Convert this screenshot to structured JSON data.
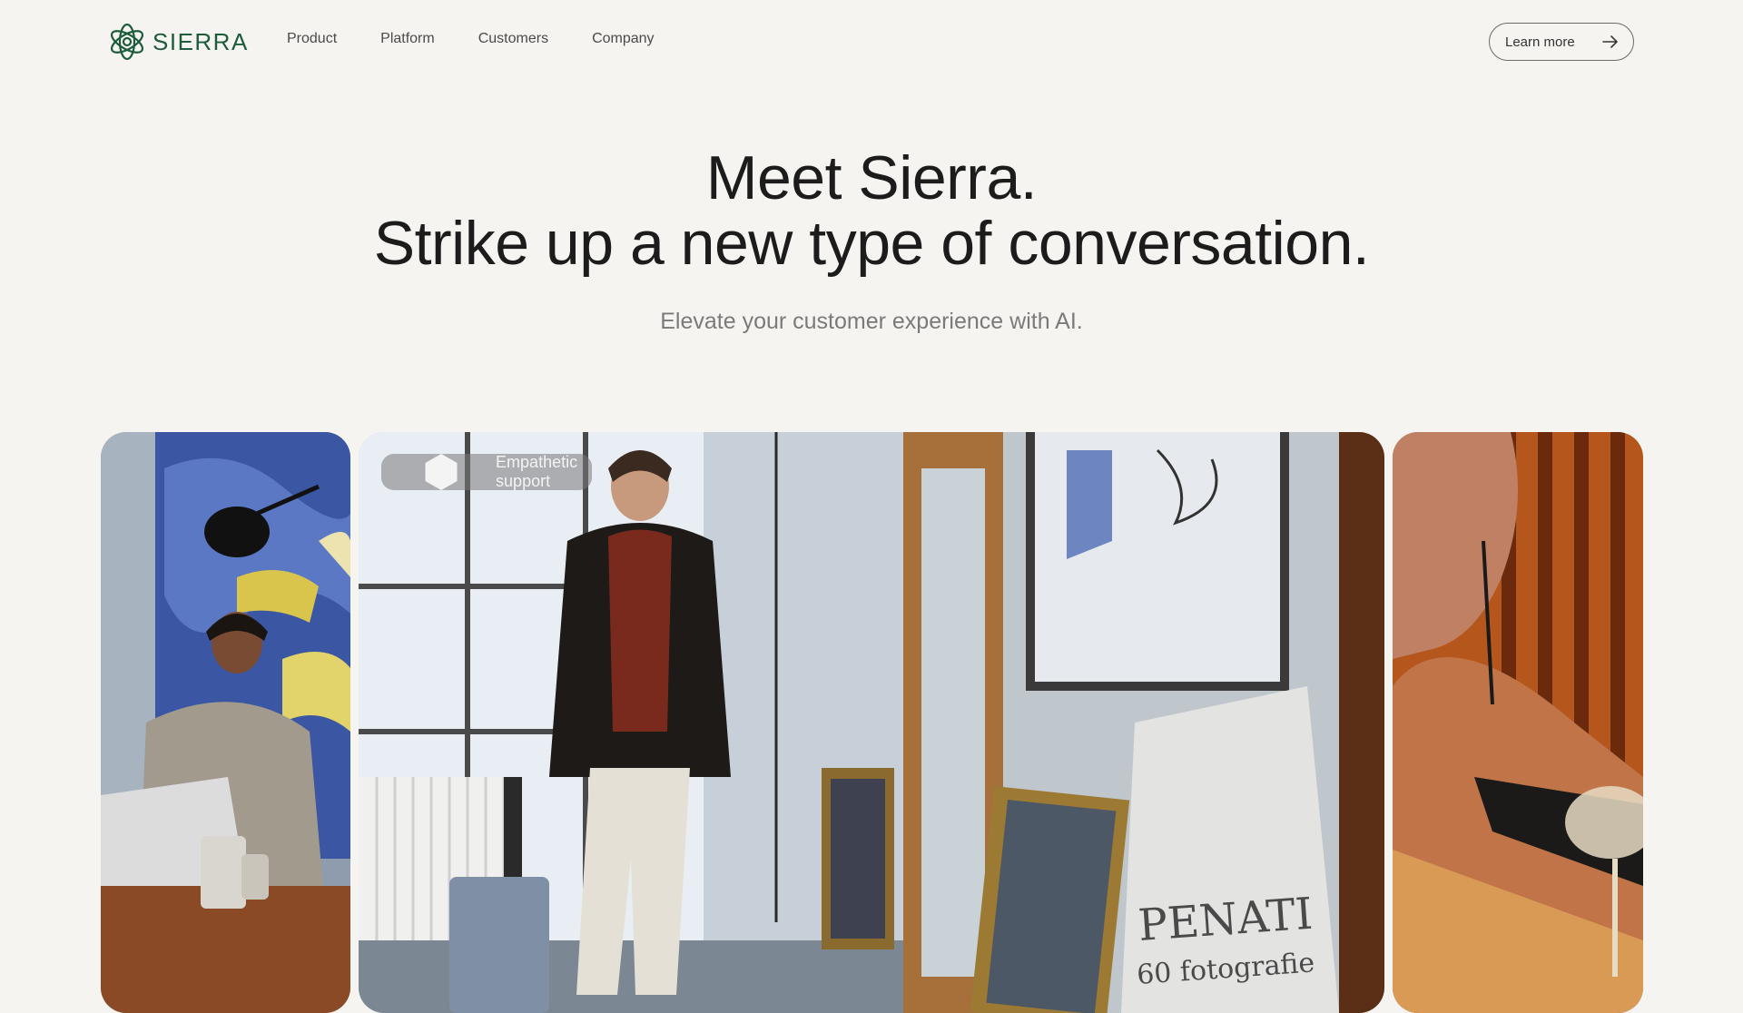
{
  "brand": {
    "name": "SIERRA",
    "logo_icon": "sierra-flower-logo-icon",
    "color": "#1d5c3a"
  },
  "nav": {
    "links": [
      "Product",
      "Platform",
      "Customers",
      "Company"
    ],
    "cta_label": "Learn more",
    "cta_icon": "arrow-right-icon"
  },
  "hero": {
    "title_line1": "Meet Sierra.",
    "title_line2": "Strike up a new type of conversation.",
    "subtitle": "Elevate your customer experience with AI."
  },
  "media": {
    "badge_label": "Empathetic support",
    "badge_icon": "hexagon-icon",
    "poster_text_line1": "PENATI",
    "poster_text_line2": "60 fotografie"
  }
}
